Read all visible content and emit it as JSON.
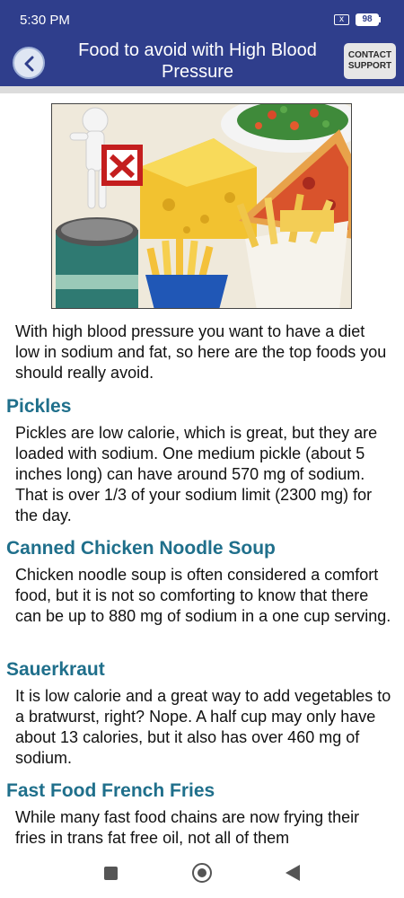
{
  "status": {
    "time": "5:30 PM",
    "sim": "x",
    "battery": "98"
  },
  "header": {
    "title": "Food to avoid with High Blood Pressure",
    "contact_label": "CONTACT SUPPORT"
  },
  "intro": "With high blood pressure you want to have a diet low in sodium and fat, so here are the top foods you should really avoid.",
  "sections": [
    {
      "heading": "Pickles",
      "body": "Pickles are low calorie, which is great, but they are loaded with sodium. One medium pickle (about 5 inches long) can have around 570 mg of sodium. That is over 1/3 of your sodium limit (2300 mg) for the day."
    },
    {
      "heading": "Canned Chicken Noodle Soup",
      "body": "Chicken noodle soup is often considered a comfort food, but it is not so comforting to know that there can be up to 880 mg of sodium in a one cup serving."
    },
    {
      "heading": "Sauerkraut",
      "body": "It is low calorie and a great way to add vegetables to a bratwurst, right? Nope. A half cup may only have about 13 calories, but it also has over 460 mg of sodium."
    },
    {
      "heading": "Fast Food French Fries",
      "body": "While many fast food chains are now frying their fries in trans fat free oil, not all of them"
    }
  ],
  "colors": {
    "appbar": "#2f3e8c",
    "heading": "#1f6f8b",
    "text": "#111111"
  }
}
